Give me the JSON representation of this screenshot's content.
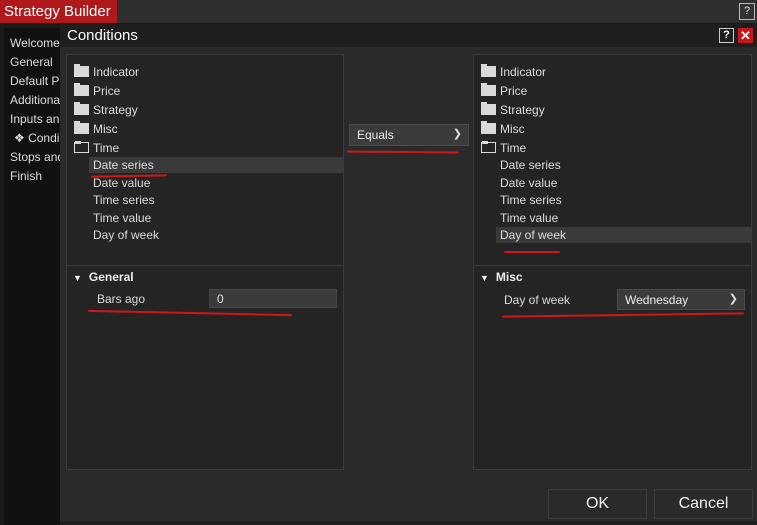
{
  "window": {
    "title": "Strategy Builder",
    "help": "?"
  },
  "leftnav": [
    "Welcome",
    "General",
    "Default P",
    "Additional",
    "Inputs and",
    "❖ Condi",
    "Stops and",
    "Finish"
  ],
  "dialog": {
    "title": "Conditions",
    "help": "?",
    "close": "✕"
  },
  "left_tree": {
    "folders": [
      "Indicator",
      "Price",
      "Strategy",
      "Misc",
      "Time"
    ],
    "time_items": [
      "Date series",
      "Date value",
      "Time series",
      "Time value",
      "Day of week"
    ],
    "selected": "Date series"
  },
  "operator": {
    "value": "Equals"
  },
  "right_tree": {
    "folders": [
      "Indicator",
      "Price",
      "Strategy",
      "Misc",
      "Time"
    ],
    "time_items": [
      "Date series",
      "Date value",
      "Time series",
      "Time value",
      "Day of week"
    ],
    "selected": "Day of week"
  },
  "left_props": {
    "section": "General",
    "label": "Bars ago",
    "value": "0"
  },
  "right_props": {
    "section": "Misc",
    "label": "Day of week",
    "value": "Wednesday"
  },
  "buttons": {
    "ok": "OK",
    "cancel": "Cancel"
  },
  "colors": {
    "accent_red": "#b0191c",
    "annotation": "#d4161a"
  }
}
